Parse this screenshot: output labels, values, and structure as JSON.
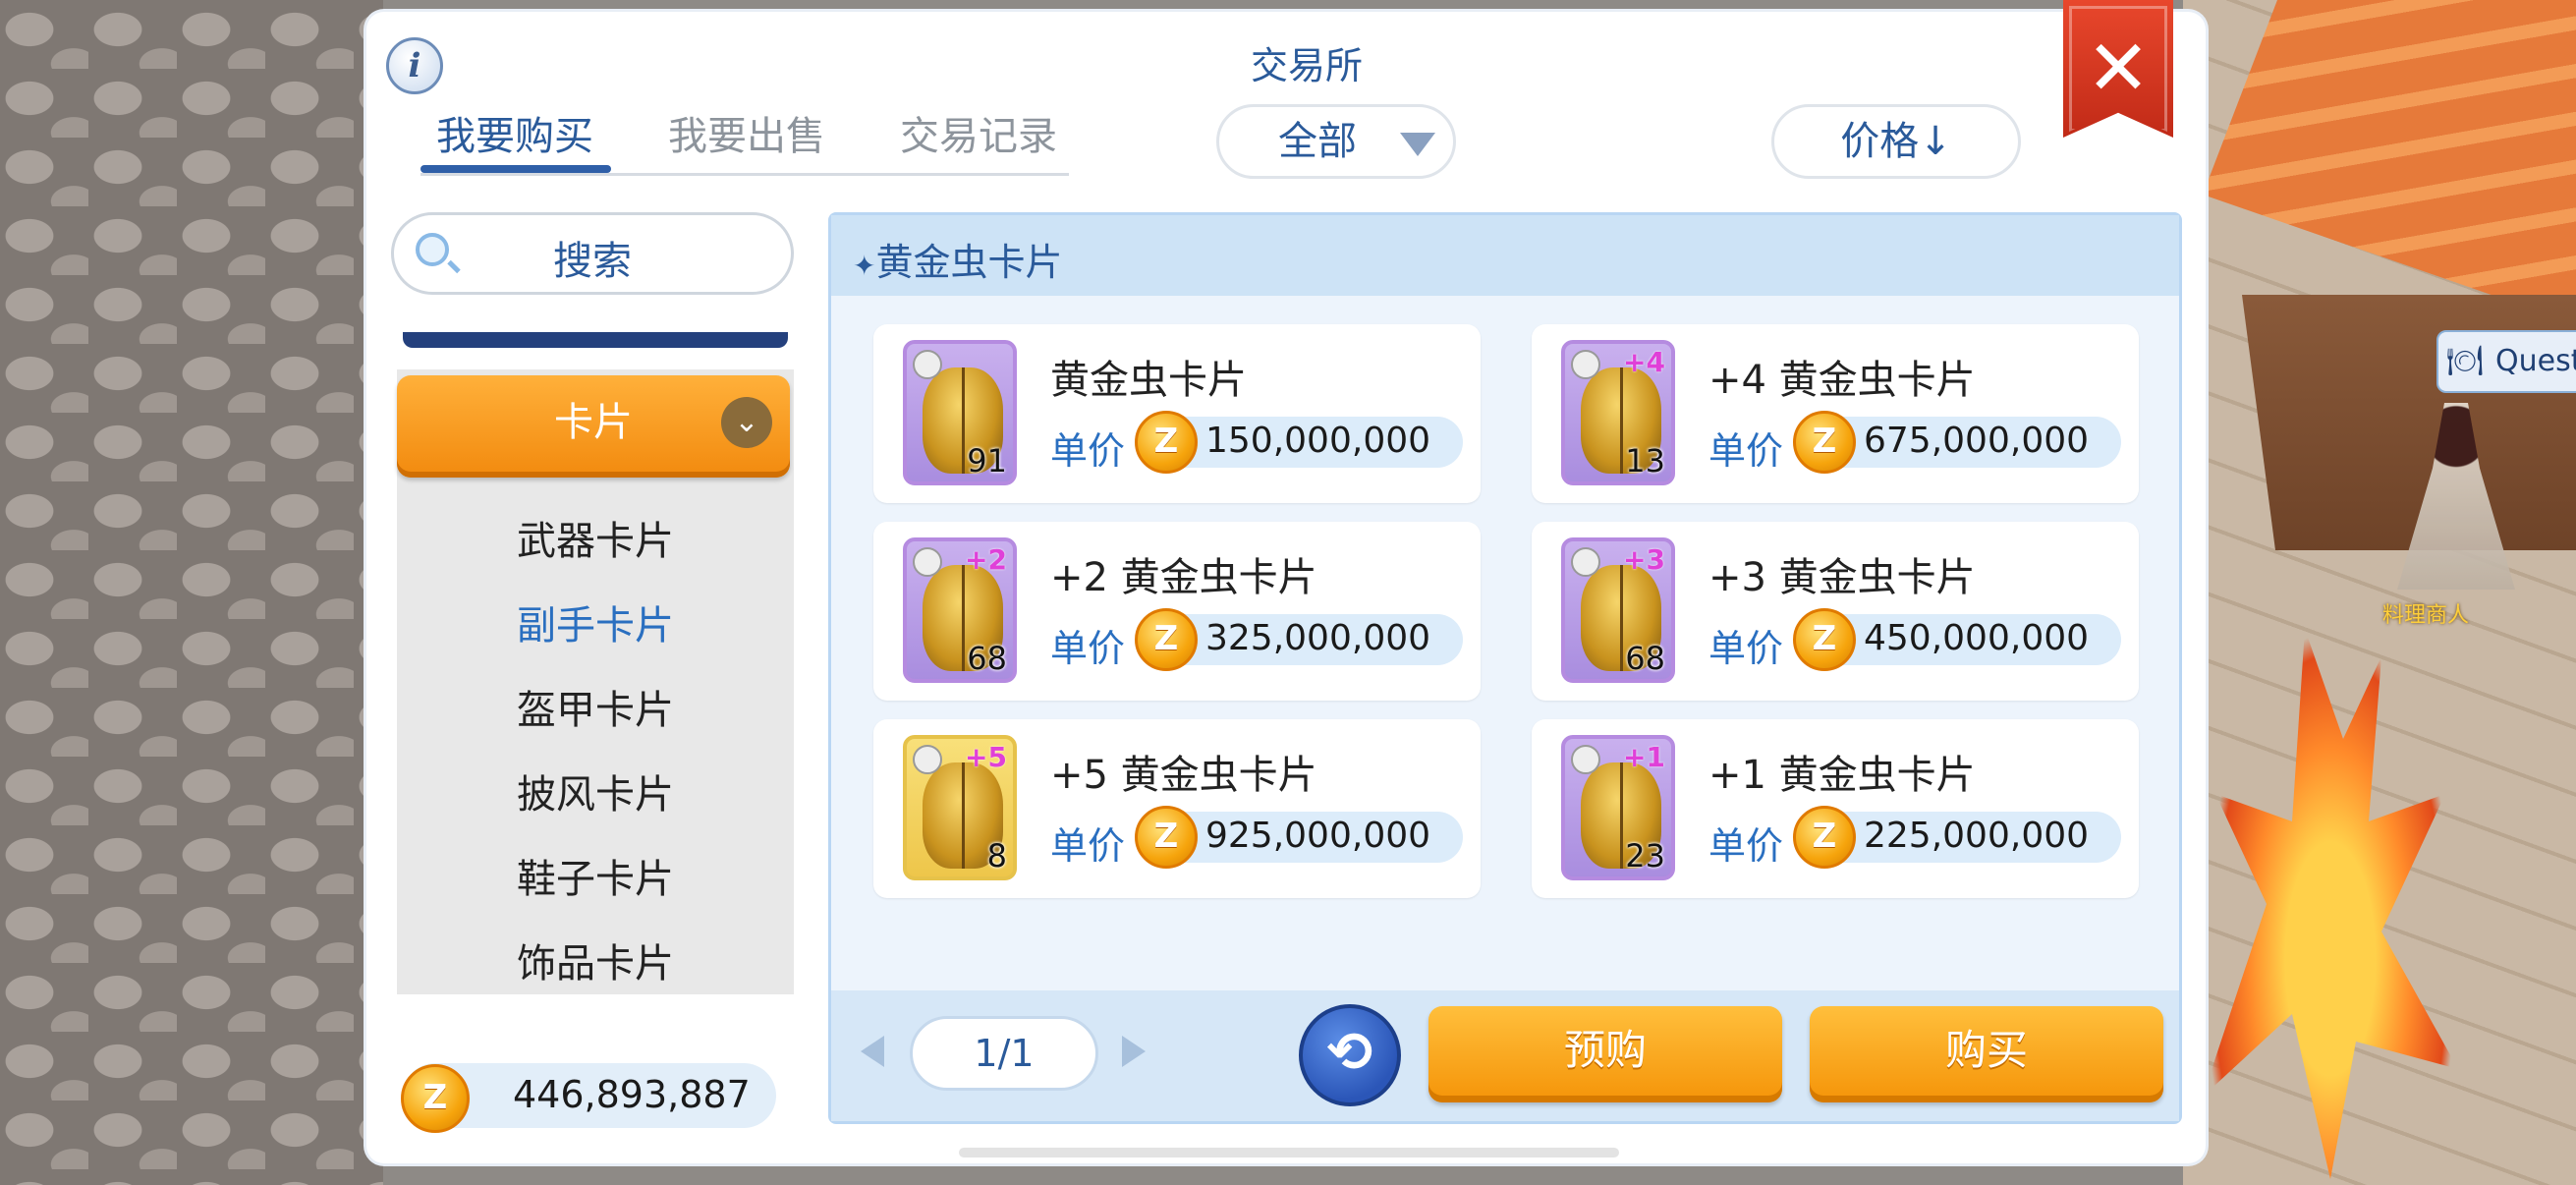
{
  "dialog": {
    "title": "交易所",
    "close_icon": "✕",
    "info_icon": "i"
  },
  "tabs": [
    {
      "label": "我要购买",
      "active": true
    },
    {
      "label": "我要出售",
      "active": false
    },
    {
      "label": "交易记录",
      "active": false
    }
  ],
  "filter": {
    "selected": "全部"
  },
  "sort": {
    "label": "价格↓"
  },
  "search": {
    "label": "搜索"
  },
  "category": {
    "header": "卡片",
    "items": [
      {
        "label": "武器卡片",
        "active": false
      },
      {
        "label": "副手卡片",
        "active": true
      },
      {
        "label": "盔甲卡片",
        "active": false
      },
      {
        "label": "披风卡片",
        "active": false
      },
      {
        "label": "鞋子卡片",
        "active": false
      },
      {
        "label": "饰品卡片",
        "active": false
      }
    ]
  },
  "balance": {
    "coin_symbol": "Z",
    "value": "446,893,887"
  },
  "results": {
    "title": "黄金虫卡片",
    "price_label": "单价",
    "listings": [
      {
        "name": "黄金虫卡片",
        "refine": "",
        "qty": "91",
        "price": "150,000,000",
        "frame": "purple"
      },
      {
        "name": "+4 黄金虫卡片",
        "refine": "+4",
        "qty": "13",
        "price": "675,000,000",
        "frame": "purple"
      },
      {
        "name": "+2 黄金虫卡片",
        "refine": "+2",
        "qty": "68",
        "price": "325,000,000",
        "frame": "purple"
      },
      {
        "name": "+3 黄金虫卡片",
        "refine": "+3",
        "qty": "68",
        "price": "450,000,000",
        "frame": "purple"
      },
      {
        "name": "+5 黄金虫卡片",
        "refine": "+5",
        "qty": "8",
        "price": "925,000,000",
        "frame": "gold"
      },
      {
        "name": "+1 黄金虫卡片",
        "refine": "+1",
        "qty": "23",
        "price": "225,000,000",
        "frame": "purple"
      }
    ]
  },
  "pager": {
    "page": "1/1"
  },
  "actions": {
    "preorder": "预购",
    "buy": "购买",
    "refresh_icon": "⟲"
  },
  "world": {
    "npc_name": "料理商人",
    "quest_tag": "Quest"
  }
}
